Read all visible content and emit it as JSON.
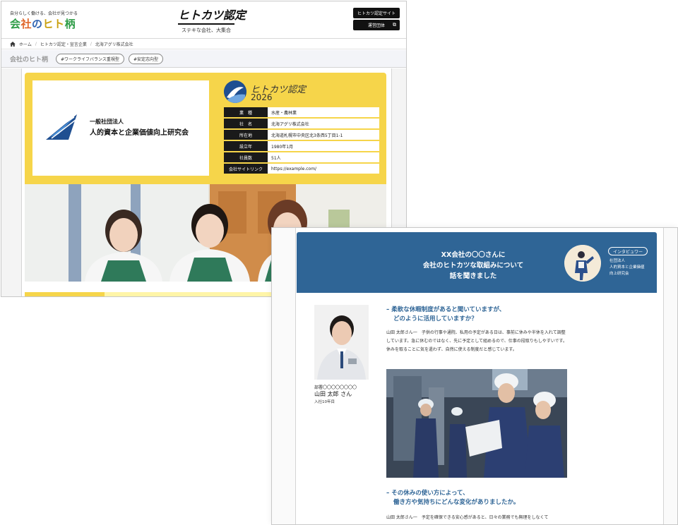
{
  "back": {
    "tagline": "自分らしく働ける、会社が見つかる",
    "logo": {
      "p1": "会",
      "p2": "社",
      "p3": "の",
      "p4": "ヒト",
      "p5": "柄"
    },
    "brand_title": "ヒトカツ認定",
    "brand_sub": "ステキな会社、大集合",
    "btn_site": "ヒトカツ認定サイト",
    "btn_org": "運営団体",
    "breadcrumb": [
      "ホーム",
      "ヒトカツ認定・宣言企業",
      "北海アグリ株式会社"
    ],
    "tagbar_logo": "会社のヒト柄",
    "tags": [
      "#ワークライフバランス重視型",
      "#安定志向型"
    ],
    "org_type": "一般社団法人",
    "org_name": "人的資本と企業価値向上研究会",
    "cert_title": "ヒトカツ認定",
    "cert_year": "2026",
    "info": [
      {
        "k": "業　種",
        "v": "水産・農林業"
      },
      {
        "k": "社　名",
        "v": "北海アグリ株式会社"
      },
      {
        "k": "所在地",
        "v": "北海道札幌市中央区北3条西5丁目1-1"
      },
      {
        "k": "設立年",
        "v": "1980年1月"
      },
      {
        "k": "社員数",
        "v": "51人"
      },
      {
        "k": "会社サイトリンク",
        "v": "https://example.com/"
      }
    ],
    "progress": 0.22
  },
  "front": {
    "banner_title": [
      "XX会社の〇〇さんに",
      "会社のヒトカツな取組みについて",
      "話を聞きました"
    ],
    "banner_tag": "インタビュワー",
    "banner_org": [
      "社団法人",
      "人的資本と企業価値",
      "向上研究会"
    ],
    "person": {
      "dept": "部署〇〇〇〇〇〇〇〇",
      "name": "山田 太郎 さん",
      "years": "入社10年目"
    },
    "q1": [
      "– 柔軟な休暇制度があると聞いていますが、",
      "どのように活用していますか？"
    ],
    "a1": "山田 太郎さん一　子供の行事や通院、私用の予定がある日は、事前に休みや半休を入れて調整しています。急に休むのではなく、先に予定として組めるので、仕事の段取りもしやすいです。休みを取ることに気を遣わず、自然に使える制度だと感じています。",
    "q2": [
      "– その休みの使い方によって、",
      "働き方や気持ちにどんな変化がありましたか。"
    ],
    "a2": "山田 太郎さん一　予定を確保できる安心感があると、日々の業務でも無理をしなくて"
  }
}
